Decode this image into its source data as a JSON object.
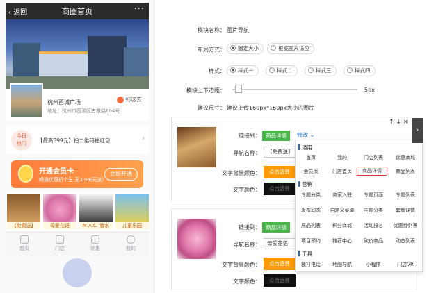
{
  "phone": {
    "back": "返回",
    "title": "商圈首页",
    "more": "···",
    "shop_name": "杭州西城广场",
    "shop_addr": "地址：杭州市西湖区古墩路604号",
    "go_here": "到这去",
    "hot_badge": [
      "今日",
      "热门"
    ],
    "hot_text": "【最高399元】扫二维码抽红包",
    "vip_title": "开通会员卡",
    "vip_sub": "畅通优惠折个生 无3.99(元送)",
    "vip_open": "立即开通",
    "products": [
      "【免费送】",
      "母爱花语",
      "M.A.C. 香水",
      "儿童乐园"
    ],
    "tabs": [
      "首页",
      "门店",
      "优惠",
      "我的"
    ]
  },
  "editor": {
    "module_name_label": "模块名称：",
    "module_name_value": "图片导航",
    "layout_label": "布局方式：",
    "layout_options": [
      "固定大小",
      "根据图片适应"
    ],
    "style_label": "样式：",
    "style_options": [
      "样式一",
      "样式二",
      "样式三",
      "样式四"
    ],
    "margin_label": "模块上下边距：",
    "margin_value": "5px",
    "size_label": "建议尺寸：",
    "size_value": "建议上传160px*160px大小的图片",
    "link_label": "链接到：",
    "name_label": "导航名称：",
    "bg_label": "文字背景颜色：",
    "color_label": "文字颜色：",
    "edit": "修改",
    "pick_color": "点击选择",
    "arrows": "↑ ↓ ×"
  },
  "cards": [
    {
      "link": "商品详情",
      "name": "【免费送】"
    },
    {
      "link": "商品详情",
      "name": "母爱花语"
    }
  ],
  "dropdown": {
    "sections": [
      {
        "title": "通用",
        "items": [
          "首页",
          "我的",
          "门店列表",
          "优惠商城",
          "会员页",
          "门店首页",
          "商品详情",
          "商品列表"
        ]
      },
      {
        "title": "营销",
        "items": [
          "专题分类",
          "商家入驻",
          "专题页面",
          "专题列表",
          "发布动态",
          "自定义菜单",
          "主题分类",
          "套餐详情",
          "展品列表",
          "积分商城",
          "活动报名",
          "优惠券列表",
          "项目预约",
          "推荐中心",
          "砍价商品",
          "动态列表"
        ]
      },
      {
        "title": "工具",
        "items": [
          "拨打电话",
          "地图导航",
          "小程序",
          "门店VR"
        ]
      }
    ],
    "selected": "商品详情"
  },
  "colors": {
    "green": "#49b54a",
    "orange": "#ff9a00",
    "link": "#1a6fd1",
    "highlight": "#e53333"
  }
}
